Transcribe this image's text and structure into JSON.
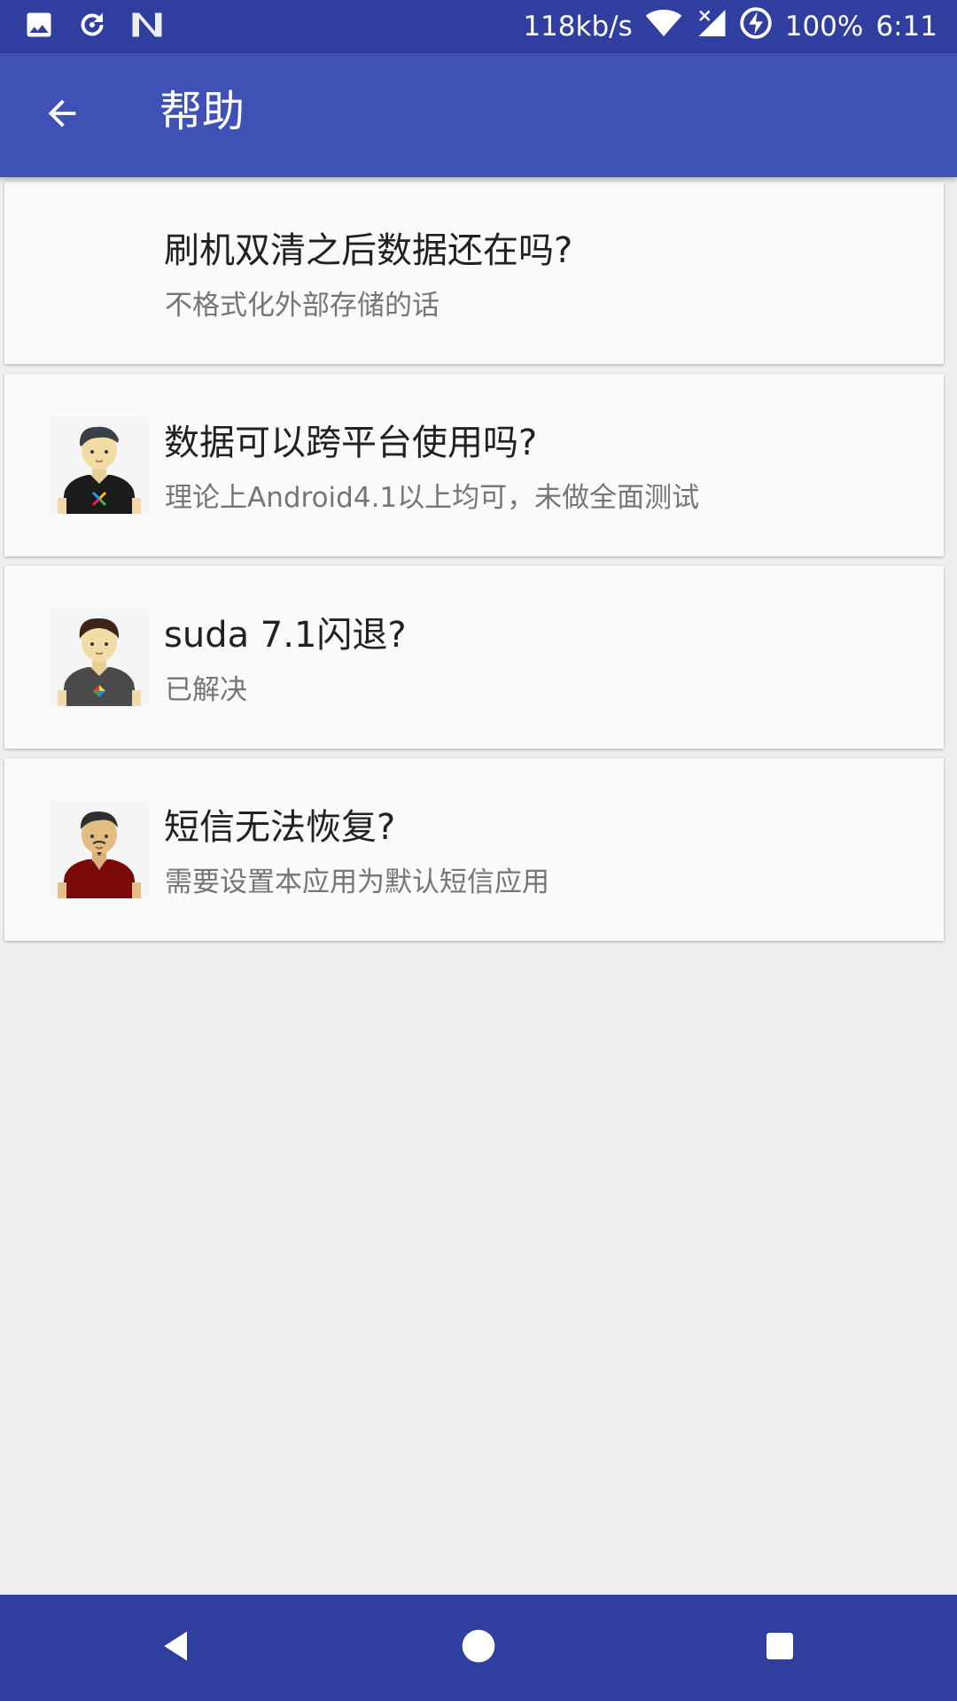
{
  "status_bar": {
    "speed": "118kb/s",
    "battery": "100%",
    "time": "6:11",
    "icons": [
      "image-icon",
      "sync-icon",
      "n-logo-icon",
      "wifi-icon",
      "signal-icon",
      "battery-charging-icon"
    ]
  },
  "app_bar": {
    "title": "帮助",
    "back_icon": "arrow-back-icon"
  },
  "items": [
    {
      "title": "刷机双清之后数据还在吗?",
      "subtitle": "不格式化外部存储的话",
      "avatar": "none"
    },
    {
      "title": "数据可以跨平台使用吗?",
      "subtitle": "理论上Android4.1以上均可，未做全面测试",
      "avatar": "avatar-black-shirt"
    },
    {
      "title": "suda 7.1闪退?",
      "subtitle": "已解决",
      "avatar": "avatar-gray-shirt"
    },
    {
      "title": "短信无法恢复?",
      "subtitle": "需要设置本应用为默认短信应用",
      "avatar": "avatar-red-shirt"
    }
  ],
  "nav_bar": {
    "icons": [
      "nav-back-icon",
      "nav-home-icon",
      "nav-recents-icon"
    ]
  },
  "colors": {
    "status_bar": "#303F9F",
    "app_bar": "#3F51B5",
    "background": "#EEEEEE",
    "card": "#FAFAFA"
  }
}
